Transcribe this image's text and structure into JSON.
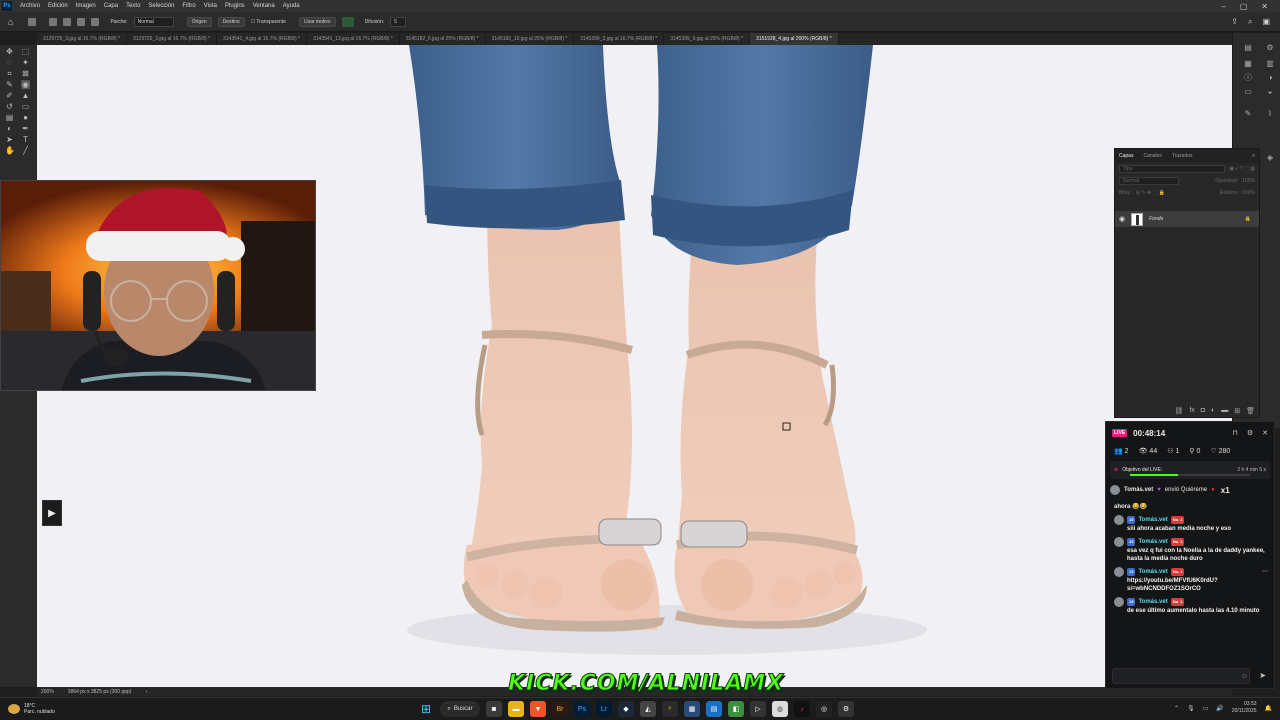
{
  "menubar": {
    "logo": "Ps",
    "items": [
      "Archivo",
      "Edición",
      "Imagen",
      "Capa",
      "Texto",
      "Selección",
      "Filtro",
      "Vista",
      "Plugins",
      "Ventana",
      "Ayuda"
    ]
  },
  "options": {
    "parche_label": "Parche:",
    "parche_value": "Normal",
    "origen": "Origen",
    "destino": "Destino",
    "transparente": "Transparente",
    "usar_motivo": "Usar motivo",
    "difusion_label": "Difusión:",
    "difusion_value": "5"
  },
  "tabs": [
    "3129725_3.jpg al 16.7% (RGB/8) *",
    "3129725_3.jpg al 16.7% (RGB/8) *",
    "3143541_4.jpg al 16.7% (RGB/8) *",
    "3143541_13.jpg al 16.7% (RGB/8) *",
    "3145182_6.jpg al 25% (RGB/8) *",
    "3145182_15.jpg al 25% (RGB/8) *",
    "3145399_3.jpg al 16.7% (RGB/8) *",
    "3145399_9.jpg al 25% (RGB/8) *",
    "3151928_4.jpg al 200% (RGB/8) *"
  ],
  "active_tab_index": 8,
  "status": {
    "zoom": "200%",
    "doc_info": "3864 px x 3825 px (300 ppp)"
  },
  "layers_panel": {
    "tabs": [
      "Capas",
      "Canales",
      "Trazados"
    ],
    "filter_placeholder": "Tipo",
    "blend_mode": "Normal",
    "opacity_label": "Opacidad:",
    "opacity_value": "100%",
    "fill_label": "Relleno:",
    "fill_value": "100%",
    "lock_label": "Bloq.:",
    "layer_name": "Fondo"
  },
  "live": {
    "badge": "LIVE",
    "elapsed": "00:48:14",
    "stats": {
      "users": "2",
      "viewers": "44",
      "subs": "1",
      "follows": "0",
      "likes": "280"
    },
    "goal_label": "Objetivo del LIVE: ",
    "goal_time": "2 h 4 min 5 s",
    "gift": {
      "user": "Tomás.vet",
      "text": "envió Quiéreme",
      "count": "x1"
    },
    "messages": [
      {
        "user": "",
        "text": "ahora 😂😂"
      },
      {
        "user": "Tomás.vet",
        "badge_level": "15",
        "badge_rank": "No. 1",
        "text": "siii ahora acaban media noche y eso"
      },
      {
        "user": "Tomás.vet",
        "badge_level": "15",
        "badge_rank": "No. 1",
        "text": "esa vez q fui con la Noelia a la de daddy yankee, hasta la media noche duro"
      },
      {
        "user": "Tomás.vet",
        "badge_level": "15",
        "badge_rank": "No. 1",
        "text": "https://youtu.be/MFVfU6K0rdU?si=wbNCNDDFOZ1SOrCO"
      },
      {
        "user": "Tomás.vet",
        "badge_level": "15",
        "badge_rank": "No. 1",
        "text": "de ese último aumentalo hasta las 4.10 minuto"
      }
    ]
  },
  "overlay": {
    "kick": "KICK.COM/ALNILAMX"
  },
  "taskbar": {
    "temp": "18°C",
    "weather": "Parc. nublado",
    "search": "Buscar",
    "time": "03:53",
    "date": "20/11/2025"
  },
  "colors": {
    "kick_green": "#53fc18",
    "live_pink": "#e21d7a",
    "ps_blue": "#31a8ff"
  }
}
